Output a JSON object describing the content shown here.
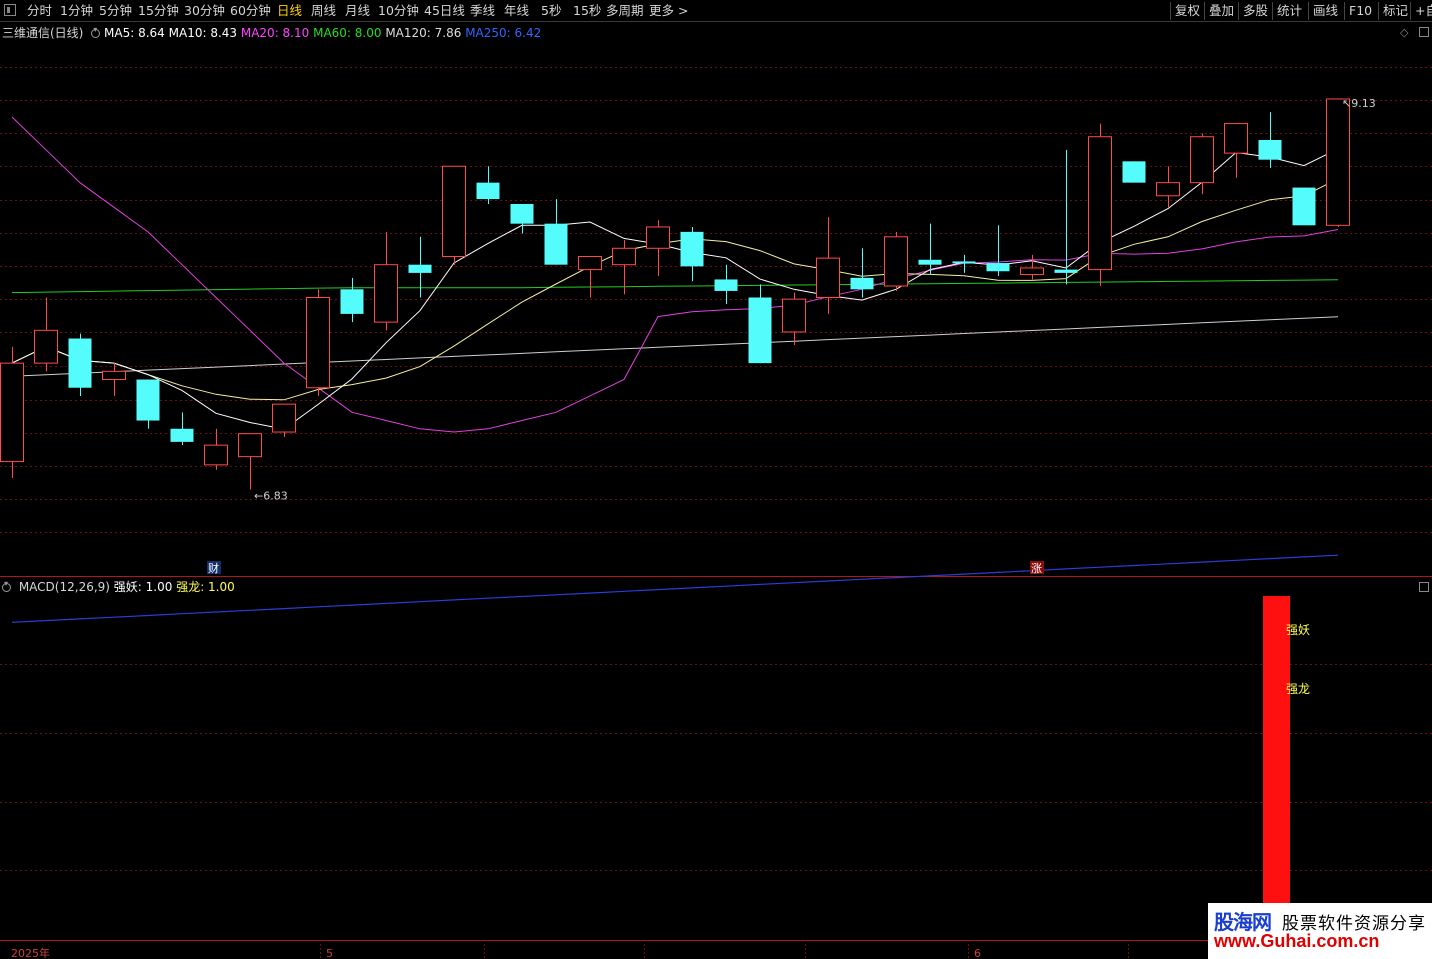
{
  "toolbar": {
    "periods": [
      "分时",
      "1分钟",
      "5分钟",
      "15分钟",
      "30分钟",
      "60分钟",
      "日线",
      "周线",
      "月线",
      "10分钟",
      "45日线",
      "季线",
      "年线",
      "5秒",
      "15秒",
      "多周期",
      "更多 >"
    ],
    "active_index": 6,
    "right_buttons": [
      "复权",
      "叠加",
      "多股",
      "统计",
      "画线",
      "F10",
      "标记",
      "+自"
    ]
  },
  "legend": {
    "title": "三维通信(日线)",
    "items": [
      {
        "label": "MA5: 8.64",
        "color": "#ffffff"
      },
      {
        "label": "MA10: 8.43",
        "color": "#ffffff"
      },
      {
        "label": "MA20: 8.10",
        "color": "#ff44ff"
      },
      {
        "label": "MA60: 8.00",
        "color": "#22dd22"
      },
      {
        "label": "MA120: 7.86",
        "color": "#dddddd"
      },
      {
        "label": "MA250: 6.42",
        "color": "#3366ff"
      }
    ]
  },
  "macd_legend": {
    "name": "MACD(12,26,9)",
    "items": [
      {
        "label": "强妖: 1.00",
        "color": "#ffffff"
      },
      {
        "label": "强龙: 1.00",
        "color": "#ffff55"
      }
    ]
  },
  "chart_data": {
    "type": "candlestick",
    "price_range": [
      6.4,
      9.6
    ],
    "high_label": "9.13",
    "low_label": "6.83",
    "markers": [
      {
        "text": "财",
        "color": "#3366ff"
      },
      {
        "text": "涨",
        "color": "#ff3333"
      }
    ],
    "macd_labels": [
      "强妖",
      "强龙"
    ],
    "x_labels": [
      "2025年",
      "5",
      "6"
    ],
    "candles": [
      {
        "o": 7.0,
        "h": 7.7,
        "l": 6.9,
        "c": 7.6
      },
      {
        "o": 7.6,
        "h": 8.0,
        "l": 7.55,
        "c": 7.8
      },
      {
        "o": 7.75,
        "h": 7.78,
        "l": 7.4,
        "c": 7.45
      },
      {
        "o": 7.5,
        "h": 7.6,
        "l": 7.4,
        "c": 7.55
      },
      {
        "o": 7.5,
        "h": 7.5,
        "l": 7.2,
        "c": 7.25
      },
      {
        "o": 7.2,
        "h": 7.3,
        "l": 7.1,
        "c": 7.12
      },
      {
        "o": 6.98,
        "h": 7.2,
        "l": 6.95,
        "c": 7.1
      },
      {
        "o": 7.03,
        "h": 7.1,
        "l": 6.83,
        "c": 7.17
      },
      {
        "o": 7.18,
        "h": 7.35,
        "l": 7.15,
        "c": 7.35
      },
      {
        "o": 7.45,
        "h": 8.05,
        "l": 7.4,
        "c": 8.0
      },
      {
        "o": 8.05,
        "h": 8.12,
        "l": 7.85,
        "c": 7.9
      },
      {
        "o": 7.85,
        "h": 8.4,
        "l": 7.8,
        "c": 8.2
      },
      {
        "o": 8.2,
        "h": 8.37,
        "l": 8.0,
        "c": 8.15
      },
      {
        "o": 8.25,
        "h": 8.8,
        "l": 8.2,
        "c": 8.8
      },
      {
        "o": 8.7,
        "h": 8.8,
        "l": 8.57,
        "c": 8.6
      },
      {
        "o": 8.57,
        "h": 8.57,
        "l": 8.39,
        "c": 8.45
      },
      {
        "o": 8.45,
        "h": 8.6,
        "l": 8.2,
        "c": 8.2
      },
      {
        "o": 8.17,
        "h": 8.25,
        "l": 8.0,
        "c": 8.25
      },
      {
        "o": 8.2,
        "h": 8.35,
        "l": 8.02,
        "c": 8.3
      },
      {
        "o": 8.3,
        "h": 8.47,
        "l": 8.13,
        "c": 8.43
      },
      {
        "o": 8.4,
        "h": 8.43,
        "l": 8.1,
        "c": 8.19
      },
      {
        "o": 8.11,
        "h": 8.2,
        "l": 7.96,
        "c": 8.04
      },
      {
        "o": 8.0,
        "h": 8.08,
        "l": 7.6,
        "c": 7.6
      },
      {
        "o": 7.79,
        "h": 8.03,
        "l": 7.71,
        "c": 7.99
      },
      {
        "o": 8.0,
        "h": 8.49,
        "l": 7.9,
        "c": 8.24
      },
      {
        "o": 8.12,
        "h": 8.3,
        "l": 8.0,
        "c": 8.05
      },
      {
        "o": 8.07,
        "h": 8.4,
        "l": 8.04,
        "c": 8.37
      },
      {
        "o": 8.23,
        "h": 8.45,
        "l": 8.14,
        "c": 8.2
      },
      {
        "o": 8.22,
        "h": 8.26,
        "l": 8.15,
        "c": 8.21
      },
      {
        "o": 8.21,
        "h": 8.44,
        "l": 8.13,
        "c": 8.16
      },
      {
        "o": 8.14,
        "h": 8.26,
        "l": 8.11,
        "c": 8.18
      },
      {
        "o": 8.17,
        "h": 8.9,
        "l": 8.08,
        "c": 8.15
      },
      {
        "o": 8.17,
        "h": 9.06,
        "l": 8.07,
        "c": 8.98
      },
      {
        "o": 8.83,
        "h": 8.83,
        "l": 8.76,
        "c": 8.7
      },
      {
        "o": 8.62,
        "h": 8.8,
        "l": 8.55,
        "c": 8.7
      },
      {
        "o": 8.7,
        "h": 9.0,
        "l": 8.63,
        "c": 8.98
      },
      {
        "o": 8.88,
        "h": 9.06,
        "l": 8.73,
        "c": 9.06
      },
      {
        "o": 8.96,
        "h": 9.13,
        "l": 8.79,
        "c": 8.84
      },
      {
        "o": 8.67,
        "h": 8.67,
        "l": 8.47,
        "c": 8.44
      },
      {
        "o": 8.44,
        "h": 9.21,
        "l": 8.43,
        "c": 9.21
      }
    ],
    "macd_bar": {
      "value": 1.0
    }
  }
}
